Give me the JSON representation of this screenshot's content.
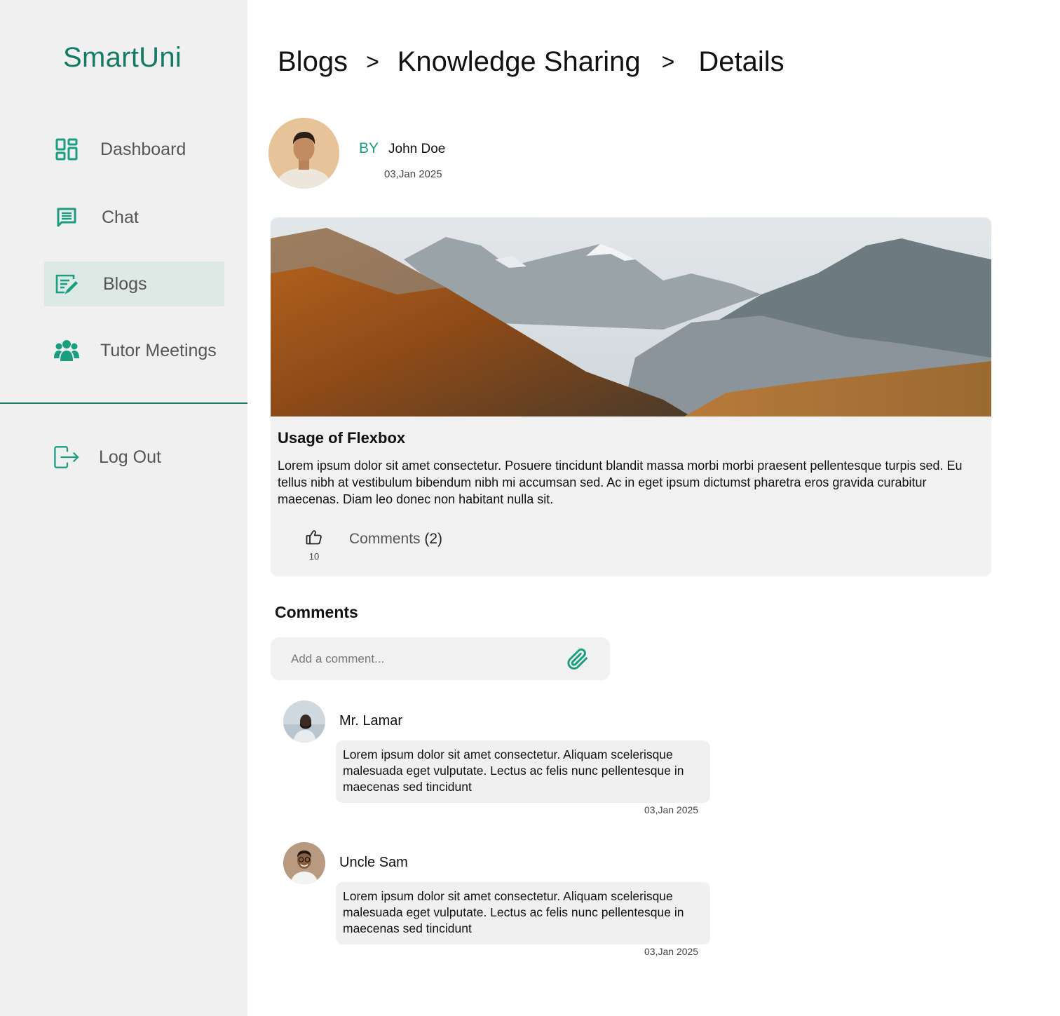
{
  "app": {
    "brand": "SmartUni"
  },
  "sidebar": {
    "items": [
      {
        "label": "Dashboard",
        "icon": "dashboard-icon",
        "active": false
      },
      {
        "label": "Chat",
        "icon": "chat-icon",
        "active": false
      },
      {
        "label": "Blogs",
        "icon": "blog-edit-icon",
        "active": true
      },
      {
        "label": "Tutor Meetings",
        "icon": "group-icon",
        "active": false
      }
    ],
    "logout": {
      "label": "Log Out",
      "icon": "logout-icon"
    }
  },
  "breadcrumb": {
    "items": [
      "Blogs",
      "Knowledge Sharing",
      "Details"
    ],
    "separator": ">"
  },
  "post": {
    "by_label": "BY",
    "author": "John Doe",
    "date": "03,Jan 2025",
    "title": "Usage of Flexbox",
    "body": "Lorem ipsum dolor sit amet consectetur. Posuere tincidunt blandit massa morbi morbi praesent pellentesque turpis sed. Eu tellus nibh at vestibulum bibendum nibh mi accumsan sed. Ac in eget ipsum dictumst pharetra eros gravida curabitur maecenas. Diam leo donec non habitant nulla sit.",
    "likes": "10",
    "comments_label": "Comments",
    "comments_count": "(2)"
  },
  "comments_section": {
    "heading": "Comments",
    "input_placeholder": "Add a comment...",
    "items": [
      {
        "name": "Mr. Lamar",
        "text": "Lorem ipsum dolor sit amet consectetur. Aliquam scelerisque malesuada eget vulputate. Lectus ac felis nunc pellentesque in maecenas sed tincidunt",
        "date": "03,Jan 2025"
      },
      {
        "name": "Uncle Sam",
        "text": "Lorem ipsum dolor sit amet consectetur. Aliquam scelerisque malesuada eget vulputate. Lectus ac felis nunc pellentesque in maecenas sed tincidunt",
        "date": "03,Jan 2025"
      }
    ]
  },
  "colors": {
    "accent": "#1b9e80",
    "brand": "#137a63",
    "sidebar_bg": "#f0f0f0",
    "active_bg": "#dde9e5",
    "card_bg": "#f1f1f1"
  }
}
